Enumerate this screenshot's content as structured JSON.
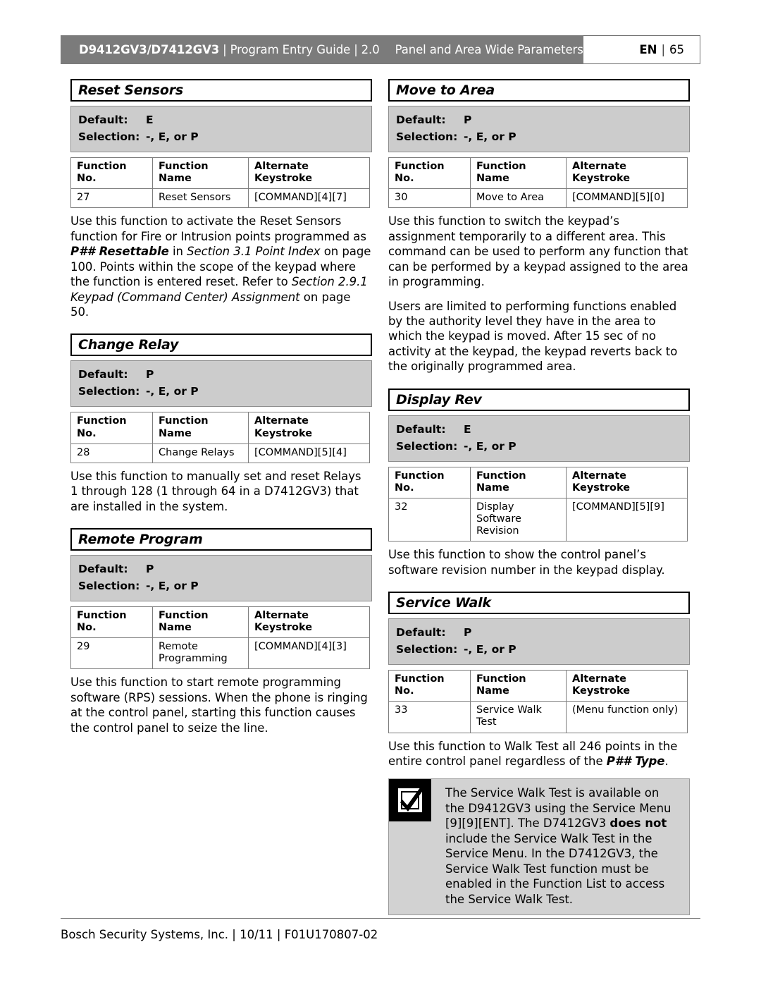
{
  "header": {
    "product": "D9412GV3/D7412GV3",
    "sep": "|",
    "guide": "Program Entry Guide",
    "version": "2.0",
    "section": "Panel and Area Wide Parameters",
    "language": "EN",
    "page_number": "65"
  },
  "table_headers": {
    "col1": "Function No.",
    "col1_line1": "Function",
    "col1_line2": "No.",
    "col2": "Function Name",
    "col3_line1": "Alternate",
    "col3_line2": "Keystroke"
  },
  "labels": {
    "default": "Default:",
    "selection": "Selection:"
  },
  "left_column": {
    "sections": [
      {
        "title": "Reset Sensors",
        "default": "E",
        "selection": "-, E, or P",
        "row": {
          "no": "27",
          "name": "Reset Sensors",
          "keystroke": "[COMMAND][4][7]"
        },
        "paragraphs": [
          "Use this function to activate the Reset Sensors function for Fire or Intrusion points programmed as P## Resettable in Section 3.1 Point Index on page 100. Points within the scope of the keypad where the function is entered reset. Refer to Section 2.9.1 Keypad (Command Center) Assignment on page 50."
        ]
      },
      {
        "title": "Change Relay",
        "default": "P",
        "selection": "-, E, or P",
        "row": {
          "no": "28",
          "name": "Change Relays",
          "keystroke": "[COMMAND][5][4]"
        },
        "paragraphs": [
          "Use this function to manually set and reset Relays 1 through 128 (1 through 64 in a D7412GV3) that are installed in the system."
        ]
      },
      {
        "title": "Remote Program",
        "default": "P",
        "selection": "-, E, or P",
        "row": {
          "no": "29",
          "name": "Remote Programming",
          "keystroke": "[COMMAND][4][3]"
        },
        "paragraphs": [
          "Use this function to start remote programming software (RPS) sessions. When the phone is ringing at the control panel, starting this function causes the control panel to seize the line."
        ]
      }
    ]
  },
  "right_column": {
    "sections": [
      {
        "title": "Move to Area",
        "default": "P",
        "selection": "-, E, or P",
        "row": {
          "no": "30",
          "name": "Move to Area",
          "keystroke": "[COMMAND][5][0]"
        },
        "paragraphs": [
          "Use this function to switch the keypad’s assignment temporarily to a different area. This command can be used to perform any function that can be performed by a keypad assigned to the area in programming.",
          "Users are limited to performing functions enabled by the authority level they have in the area to which the keypad is moved. After 15 sec of no activity at the keypad, the keypad reverts back to the originally programmed area."
        ]
      },
      {
        "title": "Display Rev",
        "default": "E",
        "selection": "-, E, or P",
        "row": {
          "no": "32",
          "name": "Display Software Revision",
          "keystroke": "[COMMAND][5][9]"
        },
        "paragraphs": [
          "Use this function to show the control panel’s software revision number in the keypad display."
        ]
      },
      {
        "title": "Service Walk",
        "default": "P",
        "selection": "-, E, or P",
        "row": {
          "no": "33",
          "name": "Service Walk Test",
          "keystroke": "(Menu function only)"
        },
        "paragraphs": [
          "Use this function to Walk Test all 246 points in the entire control panel regardless of the P## Type."
        ]
      }
    ],
    "notice": {
      "icon": "checkmark-notice-icon",
      "text_part1": "The Service Walk Test is available on the D9412GV3 using the Service Menu [9][9][ENT]. The D7412GV3 ",
      "text_bold": "does not",
      "text_part2": " include the Service Walk Test in the Service Menu. In the D7412GV3, the Service Walk Test function must be enabled in the Function List to access the Service Walk Test."
    }
  },
  "footer": {
    "text": "Bosch Security Systems, Inc. | 10/11 | F01U170807-02"
  },
  "colors": {
    "header_bar": "#7b7b7b",
    "shaded_block": "#cccccc",
    "notice_bg": "#d2d2d2",
    "rule": "#7a7a7a"
  }
}
